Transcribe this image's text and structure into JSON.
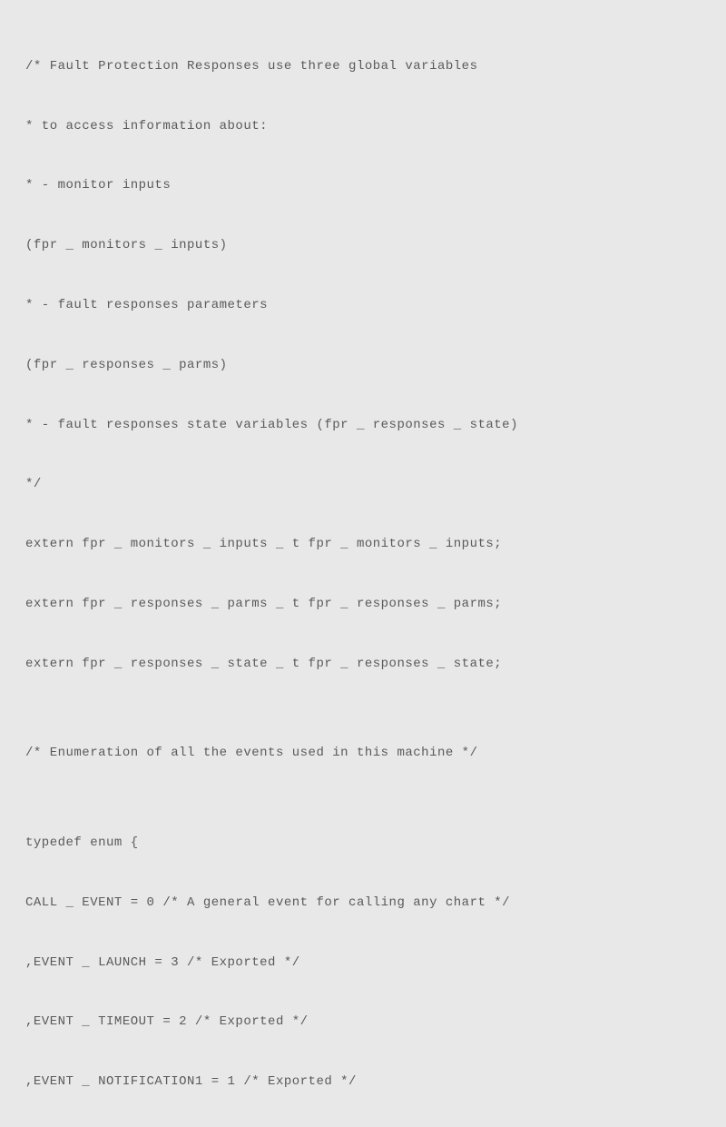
{
  "code": {
    "lines": [
      "/* Fault Protection Responses use three global variables",
      "* to access information about:",
      "* - monitor inputs",
      "(fpr _ monitors _ inputs)",
      "* - fault responses parameters",
      "(fpr _ responses _ parms)",
      "* - fault responses state variables (fpr _ responses _ state)",
      "*/",
      "extern fpr _ monitors _ inputs _ t fpr _ monitors _ inputs;",
      "extern fpr _ responses _ parms _ t fpr _ responses _ parms;",
      "extern fpr _ responses _ state _ t fpr _ responses _ state;",
      "",
      "/* Enumeration of all the events used in this machine */",
      "",
      "typedef enum {",
      "CALL _ EVENT = 0 /* A general event for calling any chart */",
      ",EVENT _ LAUNCH = 3 /* Exported */",
      ",EVENT _ TIMEOUT = 2 /* Exported */",
      ",EVENT _ NOTIFICATION1 = 1 /* Exported */"
    ]
  }
}
